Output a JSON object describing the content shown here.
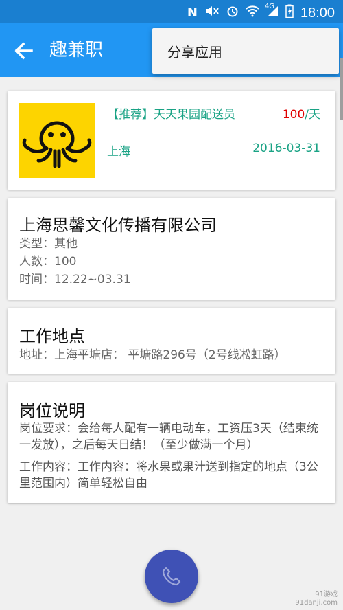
{
  "status_bar": {
    "time": "18:00",
    "signal_label": "4G"
  },
  "app_bar": {
    "title": "趣兼职"
  },
  "menu": {
    "share_label": "分享应用"
  },
  "job": {
    "title": "【推荐】天天果园配送员",
    "pay_amount": "100",
    "pay_unit": "/天",
    "city": "上海",
    "date": "2016-03-31"
  },
  "company": {
    "name": "上海思馨文化传播有限公司",
    "type_line": "类型：其他",
    "count_line": "人数：100",
    "time_line": "时间：12.22~03.31"
  },
  "location": {
    "heading": "工作地点",
    "address_line": "地址：上海平塘店： 平塘路296号（2号线凇虹路）"
  },
  "description": {
    "heading": "岗位说明",
    "requirement": "岗位要求：会给每人配有一辆电动车，工资压3天（结束统一发放），之后每天日结！（至少做满一个月）",
    "content": "工作内容：工作内容：将水果或果汁送到指定的地点（3公里范围内）简单轻松自由"
  },
  "watermark": {
    "line1": "91游戏",
    "line2": "91danji.com"
  }
}
